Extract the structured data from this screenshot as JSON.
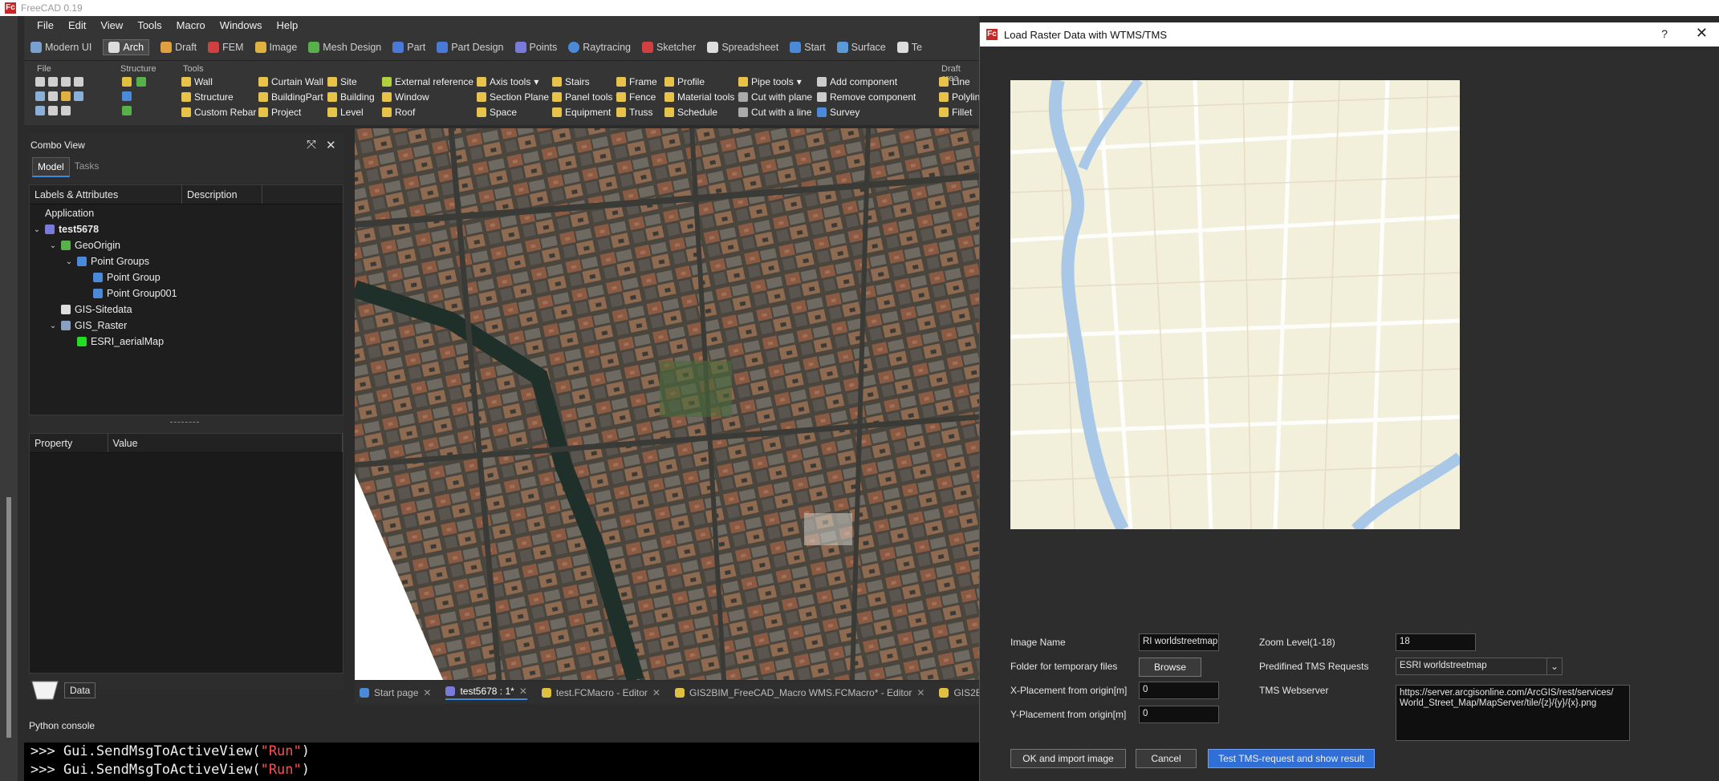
{
  "app": {
    "title": "FreeCAD 0.19",
    "logo_text": "Fc"
  },
  "menu": [
    "File",
    "Edit",
    "View",
    "Tools",
    "Macro",
    "Windows",
    "Help"
  ],
  "workbenches": [
    {
      "label": "Modern UI",
      "color": "#7aa0d0"
    },
    {
      "label": "Arch",
      "color": "#dcdcdc",
      "active": true
    },
    {
      "label": "Draft",
      "color": "#e0a040"
    },
    {
      "label": "FEM",
      "color": "#d04040"
    },
    {
      "label": "Image",
      "color": "#e0b040"
    },
    {
      "label": "Mesh Design",
      "color": "#58b04a"
    },
    {
      "label": "Part",
      "color": "#4a7ad8"
    },
    {
      "label": "Part Design",
      "color": "#4a7ad8"
    },
    {
      "label": "Points",
      "color": "#7a7ad8"
    },
    {
      "label": "Raytracing",
      "color": "#4a8ad8"
    },
    {
      "label": "Sketcher",
      "color": "#d04040"
    },
    {
      "label": "Spreadsheet",
      "color": "#dddddd"
    },
    {
      "label": "Start",
      "color": "#4a8ad8"
    },
    {
      "label": "Surface",
      "color": "#5a9ad8"
    },
    {
      "label": "Te",
      "color": "#dddddd"
    }
  ],
  "toolbar_groups": {
    "file": "File",
    "structure": "Structure",
    "tools": "Tools",
    "draft": "Draft crea"
  },
  "tools": [
    [
      "Wall",
      "Structure",
      "Custom Rebar"
    ],
    [
      "Curtain Wall",
      "BuildingPart",
      "Project"
    ],
    [
      "Site",
      "Building",
      "Level"
    ],
    [
      "External reference",
      "Window",
      "Roof"
    ],
    [
      "Axis tools",
      "Section Plane",
      "Space"
    ],
    [
      "Stairs",
      "Panel tools",
      "Equipment"
    ],
    [
      "Frame",
      "Fence",
      "Truss"
    ],
    [
      "Profile",
      "Material tools",
      "Schedule"
    ],
    [
      "Pipe tools",
      "Cut with plane",
      "Cut with a line"
    ],
    [
      "Add component",
      "Remove component",
      "Survey"
    ],
    [
      "Line",
      "Polyline",
      "Fillet"
    ]
  ],
  "combo_view": {
    "title": "Combo View",
    "tabs": [
      "Model",
      "Tasks"
    ],
    "tree_headers": [
      "Labels & Attributes",
      "Description"
    ],
    "tree": [
      {
        "label": "Application",
        "level": 0,
        "arrow": "",
        "color": ""
      },
      {
        "label": "test5678",
        "level": 0,
        "arrow": "v",
        "color": "#7a7ad8",
        "bold": true
      },
      {
        "label": "GeoOrigin",
        "level": 1,
        "arrow": "v",
        "color": "#58b04a"
      },
      {
        "label": "Point Groups",
        "level": 2,
        "arrow": "v",
        "color": "#4a8ad8"
      },
      {
        "label": "Point Group",
        "level": 3,
        "arrow": "",
        "color": "#4a8ad8"
      },
      {
        "label": "Point Group001",
        "level": 3,
        "arrow": "",
        "color": "#4a8ad8"
      },
      {
        "label": "GIS-Sitedata",
        "level": 1,
        "arrow": "",
        "color": "#dddddd"
      },
      {
        "label": "GIS_Raster",
        "level": 1,
        "arrow": "v",
        "color": "#8aa0c0"
      },
      {
        "label": "ESRI_aerialMap",
        "level": 2,
        "arrow": "",
        "color": "#22dd22"
      }
    ],
    "prop_headers": [
      "Property",
      "Value"
    ],
    "bottom_tab": "Data"
  },
  "doc_tabs": [
    {
      "label": "Start page",
      "active": false
    },
    {
      "label": "test5678 : 1*",
      "active": true
    },
    {
      "label": "test.FCMacro - Editor",
      "active": false
    },
    {
      "label": "GIS2BIM_FreeCAD_Macro WMS.FCMacro* - Editor",
      "active": false
    },
    {
      "label": "GIS2B",
      "active": false
    }
  ],
  "python_console": {
    "title": "Python console",
    "lines": [
      {
        "prefix": ">>> Gui.SendMsgToActiveView(",
        "arg": "\"Run\"",
        "suffix": ")"
      },
      {
        "prefix": ">>> Gui.SendMsgToActiveView(",
        "arg": "\"Run\"",
        "suffix": ")"
      }
    ]
  },
  "dialog": {
    "title": "Load Raster Data with WTMS/TMS",
    "help": "?",
    "close": "✕",
    "image_name_label": "Image Name",
    "image_name_value": "RI worldstreetmap",
    "folder_label": "Folder for temporary files",
    "browse_label": "Browse",
    "x_label": "X-Placement from origin[m]",
    "x_value": "0",
    "y_label": "Y-Placement from origin[m]",
    "y_value": "0",
    "zoom_label": "Zoom Level(1-18)",
    "zoom_value": "18",
    "predefined_label": "Predifined TMS Requests",
    "predefined_value": "ESRI worldstreetmap",
    "webserver_label": "TMS Webserver",
    "webserver_value": "https://server.arcgisonline.com/ArcGIS/rest/services/\nWorld_Street_Map/MapServer/tile/{z}/{y}/{x}.png",
    "ok_label": "OK and import image",
    "cancel_label": "Cancel",
    "test_label": "Test TMS-request and show result"
  }
}
